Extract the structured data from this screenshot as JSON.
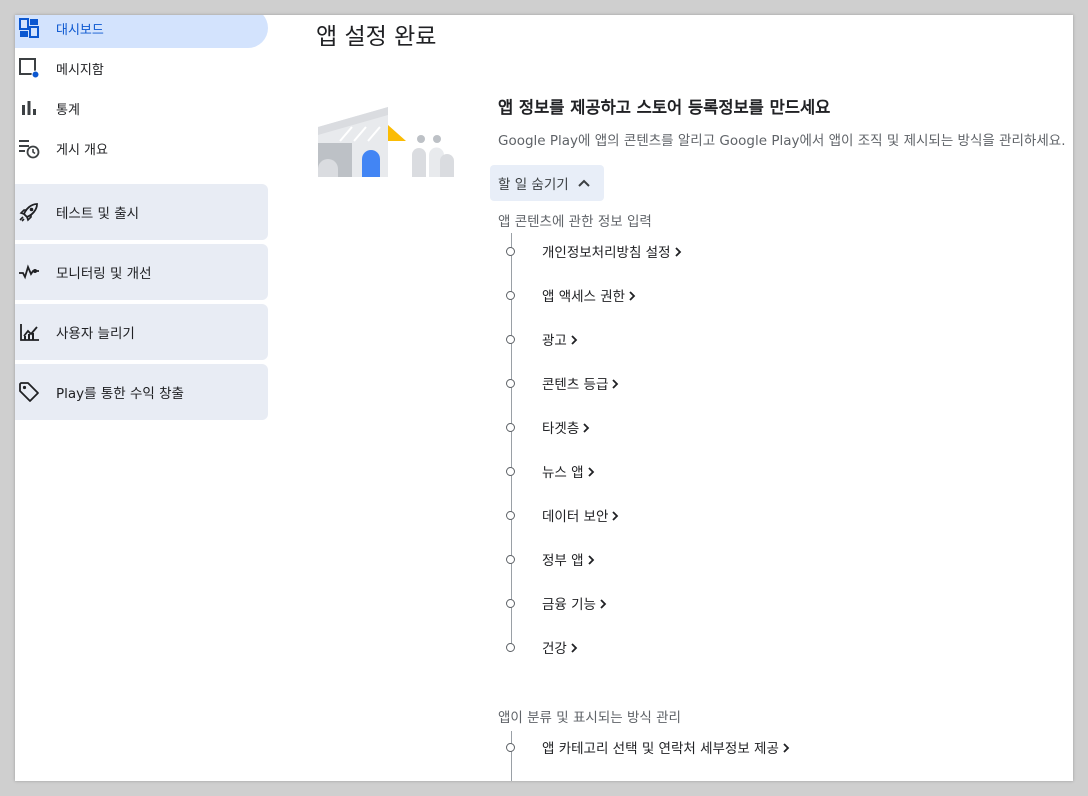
{
  "sidebar": {
    "items": [
      {
        "label": "대시보드",
        "icon": "dashboard-icon",
        "active": true
      },
      {
        "label": "메시지함",
        "icon": "inbox-icon"
      },
      {
        "label": "통계",
        "icon": "bar-chart-icon"
      },
      {
        "label": "게시 개요",
        "icon": "publishing-overview-icon"
      }
    ],
    "groups": [
      {
        "label": "테스트 및 출시",
        "icon": "rocket-icon"
      },
      {
        "label": "모니터링 및 개선",
        "icon": "vitals-icon"
      },
      {
        "label": "사용자 늘리기",
        "icon": "grow-users-icon"
      },
      {
        "label": "Play를 통한 수익 창출",
        "icon": "tag-icon"
      }
    ]
  },
  "main": {
    "title": "앱 설정 완료",
    "section_title": "앱 정보를 제공하고 스토어 등록정보를 만드세요",
    "section_desc": "Google Play에 앱의 콘텐츠를 알리고 Google Play에서 앱이 조직 및 제시되는 방식을 관리하세요.",
    "hide_tasks_label": "할 일 숨기기",
    "group1_label": "앱 콘텐츠에 관한 정보 입력",
    "group1_tasks": [
      "개인정보처리방침 설정",
      "앱 액세스 권한",
      "광고",
      "콘텐츠 등급",
      "타겟층",
      "뉴스 앱",
      "데이터 보안",
      "정부 앱",
      "금융 기능",
      "건강"
    ],
    "group2_label": "앱이 분류 및 표시되는 방식 관리",
    "group2_tasks": [
      "앱 카테고리 선택 및 연락처 세부정보 제공"
    ]
  },
  "colors": {
    "accent": "#0b57d0",
    "active_bg": "#d3e3fd",
    "group_bg": "#e8ecf4",
    "illustration_yellow": "#fbbc04",
    "illustration_blue": "#4285f4"
  }
}
